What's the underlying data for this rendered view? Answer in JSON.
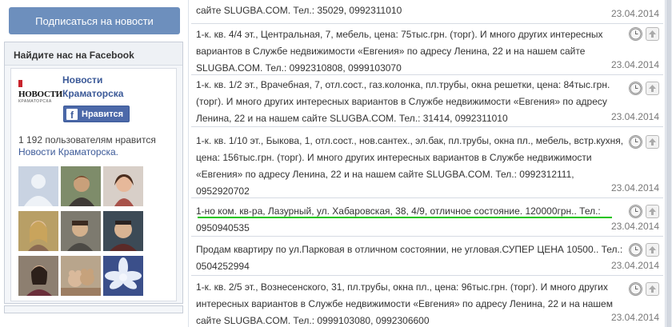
{
  "sidebar": {
    "subscribe_label": "Подписаться на новости",
    "facebook_box": {
      "title": "Найдите нас на Facebook",
      "logo_text": "НОВОСТИ",
      "logo_subtext": "КРАМАТОРСКА",
      "page_name": "Новости Краматорска",
      "like_label": "Нравится",
      "count_text": "1 192 пользователям нравится",
      "count_link": "Новости Краматорска.",
      "avatars": [
        "avatar-1",
        "avatar-2",
        "avatar-3",
        "avatar-4",
        "avatar-5",
        "avatar-6",
        "avatar-7",
        "avatar-8",
        "avatar-9"
      ]
    }
  },
  "listings": [
    {
      "text": "сайте SLUGBA.COM. Тел.: 35029, 0992311010",
      "date": "23.04.2014"
    },
    {
      "text": "1-к. кв. 4/4 эт., Центральная, 7, мебель, цена: 75тыс.грн. (торг). И много других интересных вариантов в Службе недвижимости «Евгения» по адресу Ленина, 22 и на нашем сайте SLUGBA.COM. Тел.: 0992310808, 0999103070",
      "date": "23.04.2014"
    },
    {
      "text": "1-к. кв. 1/2 эт., Врачебная, 7, отл.сост., газ.колонка, пл.трубы, окна решетки, цена: 84тыс.грн. (торг). И много других интересных вариантов в Службе недвижимости «Евгения» по адресу Ленина, 22 и на нашем сайте SLUGBA.COM. Тел.: 31414, 0992311010",
      "date": "23.04.2014"
    },
    {
      "text": "1-к. кв. 1/10 эт., Быкова, 1, отл.сост., нов.сантех., эл.бак, пл.трубы, окна пл., мебель, встр.кухня, цена: 156тыс.грн. (торг). И много других интересных вариантов в Службе недвижимости «Евгения» по адресу Ленина, 22 и на нашем сайте SLUGBA.COM. Тел.: 0992312111, 0952920702",
      "date": "23.04.2014"
    },
    {
      "text": "1-но ком. кв-ра, Лазурный, ул. Хабаровская, 38, 4/9, отличное состояние. 120000грн.. Тел.: 0950940535",
      "date": "23.04.2014"
    },
    {
      "text": "Продам квартиру по ул.Парковая в отличном состоянии, не угловая.СУПЕР ЦЕНА 10500.. Тел.: 0504252994",
      "date": "23.04.2014"
    },
    {
      "text": "1-к. кв. 2/5 эт., Вознесенского, 31, пл.трубы, окна пл., цена: 96тыс.грн. (торг). И много других интересных вариантов в Службе недвижимости «Евгения» по адресу Ленина, 22 и на нашем сайте SLUGBA.COM. Тел.: 0999103080, 0992306600",
      "date": "23.04.2014"
    }
  ],
  "colors": {
    "accent": "#6d8fbd",
    "facebook_blue": "#3b5998",
    "highlight": "#18c400"
  }
}
